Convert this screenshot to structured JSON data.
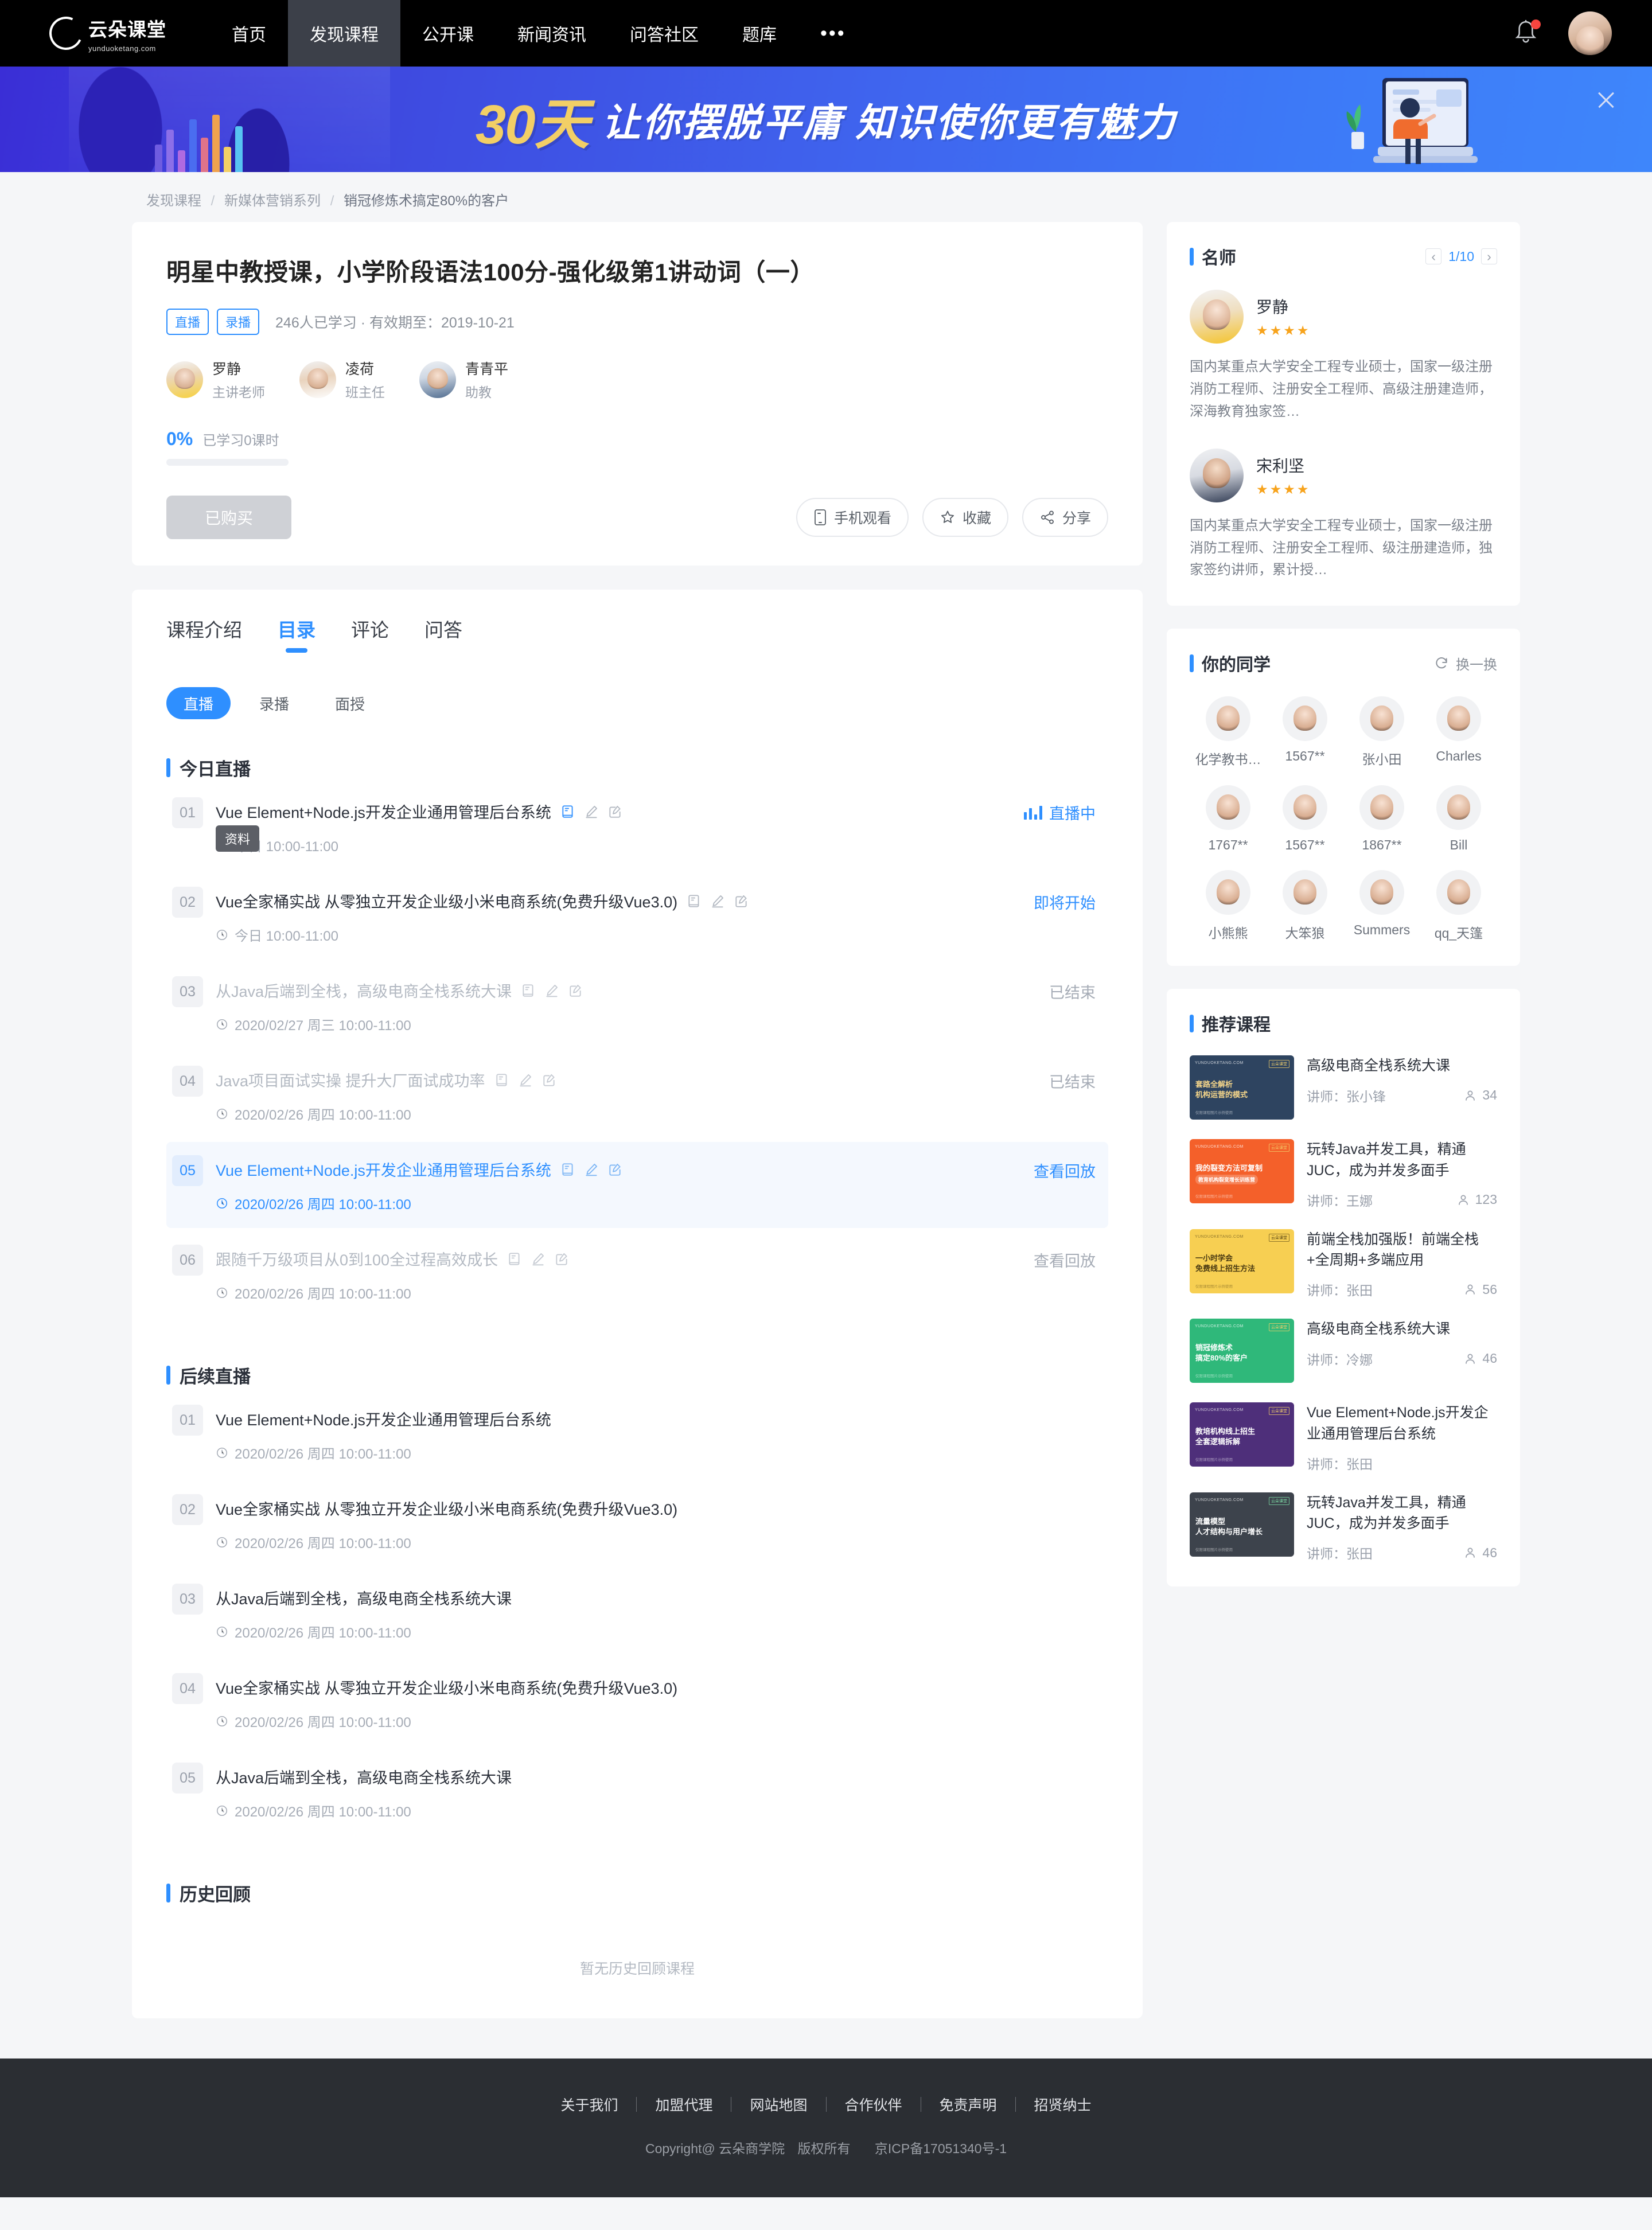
{
  "header": {
    "logo_title": "云朵课堂",
    "logo_sub": "yunduoketang.com",
    "nav": [
      {
        "label": "首页",
        "active": false
      },
      {
        "label": "发现课程",
        "active": true
      },
      {
        "label": "公开课",
        "active": false
      },
      {
        "label": "新闻资讯",
        "active": false
      },
      {
        "label": "问答社区",
        "active": false
      },
      {
        "label": "题库",
        "active": false
      },
      {
        "label": "•••",
        "active": false
      }
    ],
    "bell_icon": "bell-icon",
    "avatar_icon": "user-avatar"
  },
  "banner": {
    "highlight": "30天",
    "text": "让你摆脱平庸  知识使你更有魅力",
    "close_icon": "close-icon"
  },
  "breadcrumb": {
    "item1": "发现课程",
    "item2": "新媒体营销系列",
    "current": "销冠修炼术搞定80%的客户",
    "sep": "/"
  },
  "course": {
    "title": "明星中教授课，小学阶段语法100分-强化级第1讲动词（一）",
    "tags": [
      "直播",
      "录播"
    ],
    "meta": "246人已学习 · 有效期至：2019-10-21",
    "teachers": [
      {
        "name": "罗静",
        "role": "主讲老师"
      },
      {
        "name": "凌荷",
        "role": "班主任"
      },
      {
        "name": "青青平",
        "role": "助教"
      }
    ],
    "progress_pct": "0%",
    "progress_label": "已学习0课时",
    "buy_button": "已购买",
    "actions": [
      {
        "label": "手机观看",
        "icon": "mobile-icon"
      },
      {
        "label": "收藏",
        "icon": "star-icon"
      },
      {
        "label": "分享",
        "icon": "share-icon"
      }
    ]
  },
  "tabs": [
    {
      "label": "课程介绍",
      "active": false
    },
    {
      "label": "目录",
      "active": true
    },
    {
      "label": "评论",
      "active": false
    },
    {
      "label": "问答",
      "active": false
    }
  ],
  "pills": [
    {
      "label": "直播",
      "active": true
    },
    {
      "label": "录播",
      "active": false
    },
    {
      "label": "面授",
      "active": false
    }
  ],
  "catalog": {
    "today_title": "今日直播",
    "upcoming_title": "后续直播",
    "history_title": "历史回顾",
    "history_empty": "暂无历史回顾课程",
    "tooltip": "资料",
    "today": [
      {
        "num": "01",
        "title": "Vue Element+Node.js开发企业通用管理后台系统",
        "time": "今日 10:00-11:00",
        "status": "直播中",
        "state": "live",
        "icons": true
      },
      {
        "num": "02",
        "title": "Vue全家桶实战 从零独立开发企业级小米电商系统(免费升级Vue3.0)",
        "time": "今日 10:00-11:00",
        "status": "即将开始",
        "state": "soon",
        "icons": true
      },
      {
        "num": "03",
        "title": "从Java后端到全栈，高级电商全栈系统大课",
        "time": "2020/02/27 周三 10:00-11:00",
        "status": "已结束",
        "state": "past",
        "icons": true
      },
      {
        "num": "04",
        "title": "Java项目面试实操 提升大厂面试成功率",
        "time": "2020/02/26 周四 10:00-11:00",
        "status": "已结束",
        "state": "past",
        "icons": true
      },
      {
        "num": "05",
        "title": "Vue Element+Node.js开发企业通用管理后台系统",
        "time": "2020/02/26 周四 10:00-11:00",
        "status": "查看回放",
        "state": "highlight",
        "icons": true
      },
      {
        "num": "06",
        "title": "跟随千万级项目从0到100全过程高效成长",
        "time": "2020/02/26 周四 10:00-11:00",
        "status": "查看回放",
        "state": "past",
        "icons": true
      }
    ],
    "upcoming": [
      {
        "num": "01",
        "title": "Vue Element+Node.js开发企业通用管理后台系统",
        "time": "2020/02/26 周四 10:00-11:00",
        "status": "",
        "state": "plain",
        "icons": false
      },
      {
        "num": "02",
        "title": "Vue全家桶实战 从零独立开发企业级小米电商系统(免费升级Vue3.0)",
        "time": "2020/02/26 周四 10:00-11:00",
        "status": "",
        "state": "plain",
        "icons": false
      },
      {
        "num": "03",
        "title": "从Java后端到全栈，高级电商全栈系统大课",
        "time": "2020/02/26 周四 10:00-11:00",
        "status": "",
        "state": "plain",
        "icons": false
      },
      {
        "num": "04",
        "title": "Vue全家桶实战 从零独立开发企业级小米电商系统(免费升级Vue3.0)",
        "time": "2020/02/26 周四 10:00-11:00",
        "status": "",
        "state": "plain",
        "icons": false
      },
      {
        "num": "05",
        "title": "从Java后端到全栈，高级电商全栈系统大课",
        "time": "2020/02/26 周四 10:00-11:00",
        "status": "",
        "state": "plain",
        "icons": false
      }
    ]
  },
  "sidebar": {
    "teachers_panel": {
      "title": "名师",
      "page": "1/10",
      "prev_icon": "chevron-left-icon",
      "next_icon": "chevron-right-icon",
      "items": [
        {
          "name": "罗静",
          "stars": "★★★★",
          "desc": "国内某重点大学安全工程专业硕士，国家一级注册消防工程师、注册安全工程师、高级注册建造师，深海教育独家签…"
        },
        {
          "name": "宋利坚",
          "stars": "★★★★",
          "desc": "国内某重点大学安全工程专业硕士，国家一级注册消防工程师、注册安全工程师、级注册建造师，独家签约讲师，累计授…"
        }
      ]
    },
    "classmates_panel": {
      "title": "你的同学",
      "refresh_label": "换一换",
      "refresh_icon": "refresh-icon",
      "items": [
        {
          "name": "化学教书…"
        },
        {
          "name": "1567**"
        },
        {
          "name": "张小田"
        },
        {
          "name": "Charles"
        },
        {
          "name": "1767**"
        },
        {
          "name": "1567**"
        },
        {
          "name": "1867**"
        },
        {
          "name": "Bill"
        },
        {
          "name": "小熊熊"
        },
        {
          "name": "大笨狼"
        },
        {
          "name": "Summers"
        },
        {
          "name": "qq_天篷"
        }
      ]
    },
    "recommend_panel": {
      "title": "推荐课程",
      "teacher_prefix": "讲师：",
      "items": [
        {
          "title": "高级电商全栈系统大课",
          "teacher": "张小锋",
          "count": "34",
          "thumb_color": "#2e4460",
          "thumb_text_color": "#f4d58a",
          "thumb_line1": "套路全解析",
          "thumb_line2": "机构运营的模式",
          "thumb_brand": "YUNDUOKETANG.COM",
          "thumb_badge": "云朵课堂",
          "thumb_foot": "仅限课程图片示例使用"
        },
        {
          "title": "玩转Java并发工具，精通JUC，成为并发多面手",
          "teacher": "王娜",
          "count": "123",
          "thumb_color": "#f4602a",
          "thumb_text_color": "#ffffff",
          "thumb_line1": "我的裂变方法可复制",
          "thumb_line2": "教育机构裂变增长训练营",
          "thumb_brand": "YUNDUOKETANG.COM",
          "thumb_badge": "云朵课堂",
          "thumb_foot": "仅限课程图片示例使用"
        },
        {
          "title": "前端全栈加强版！前端全栈+全周期+多端应用",
          "teacher": "张田",
          "count": "56",
          "thumb_color": "#f7cf52",
          "thumb_text_color": "#4a3a12",
          "thumb_line1": "一小时学会",
          "thumb_line2": "免费线上招生方法",
          "thumb_brand": "YUNDUOKETANG.COM",
          "thumb_badge": "云朵课堂",
          "thumb_foot": "仅限课程图片示例使用"
        },
        {
          "title": "高级电商全栈系统大课",
          "teacher": "冷娜",
          "count": "46",
          "thumb_color": "#2fb87a",
          "thumb_text_color": "#ffffff",
          "thumb_line1": "销冠修炼术",
          "thumb_line2": "搞定80%的客户",
          "thumb_brand": "YUNDUOKETANG.COM",
          "thumb_badge": "云朵课堂",
          "thumb_foot": "仅限课程图片示例使用"
        },
        {
          "title": "Vue Element+Node.js开发企业通用管理后台系统",
          "teacher": "张田",
          "count": "",
          "thumb_color": "#4e2f7a",
          "thumb_text_color": "#ffffff",
          "thumb_line1": "教培机构线上招生",
          "thumb_line2": "全套逻辑拆解",
          "thumb_brand": "YUNDUOKETANG.COM",
          "thumb_badge": "云朵课堂",
          "thumb_foot": "仅限课程图片示例使用"
        },
        {
          "title": "玩转Java并发工具，精通JUC，成为并发多面手",
          "teacher": "张田",
          "count": "46",
          "thumb_color": "#3d434c",
          "thumb_text_color": "#ffffff",
          "thumb_line1": "流量模型",
          "thumb_line2": "人才结构与用户增长",
          "thumb_brand": "YUNDUOKETANG.COM",
          "thumb_badge": "云朵课堂",
          "thumb_foot": "仅限课程图片示例使用"
        }
      ]
    }
  },
  "footer": {
    "links": [
      "关于我们",
      "加盟代理",
      "网站地图",
      "合作伙伴",
      "免责声明",
      "招贤纳士"
    ],
    "copyright": "Copyright@ 云朵商学院",
    "rights": "版权所有",
    "icp": "京ICP备17051340号-1"
  },
  "colors": {
    "accent": "#2e8fff",
    "banner_highlight": "#f2cf66",
    "star": "#f7a31c",
    "header_bg": "#000000",
    "footer_bg": "#2b2e33"
  }
}
